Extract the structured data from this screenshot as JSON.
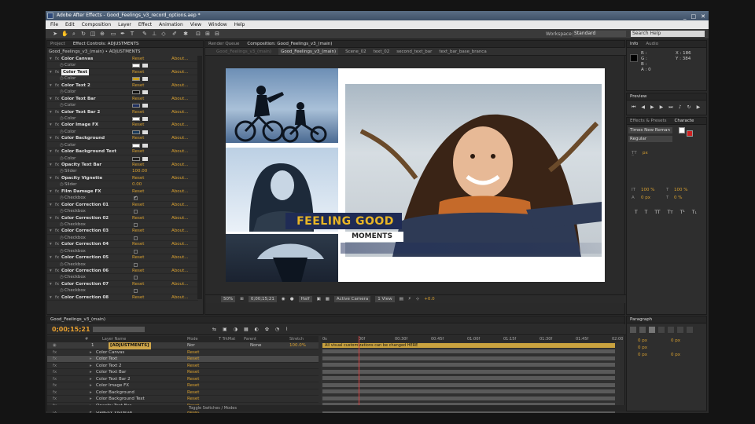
{
  "window": {
    "title": "Adobe After Effects - Good_Feelings_v3_record_options.aep *",
    "controls": [
      "_",
      "□",
      "✕"
    ]
  },
  "menu": [
    "File",
    "Edit",
    "Composition",
    "Layer",
    "Effect",
    "Animation",
    "View",
    "Window",
    "Help"
  ],
  "toolbar": {
    "workspace_label": "Workspace:",
    "workspace_value": "Standard",
    "search_placeholder": "Search Help"
  },
  "effects_panel": {
    "tabs": [
      "Project",
      "Effect Controls: ADJUSTMENTS"
    ],
    "header": "Good_Feelings_v3_(main) • ADJUSTMENTS",
    "reset_label": "Reset",
    "about_label": "About...",
    "rows": [
      {
        "name": "Color Canvas",
        "sub": "Color",
        "kind": "color",
        "swatch": "#ffffff"
      },
      {
        "name": "Color Text",
        "sub": "Color",
        "kind": "color",
        "swatch": "#c9a020"
      },
      {
        "name": "Color Text 2",
        "sub": "Color",
        "kind": "color",
        "swatch": "#111111"
      },
      {
        "name": "Color Text Bar",
        "sub": "Color",
        "kind": "color",
        "swatch": "#1e2f60"
      },
      {
        "name": "Color Text Bar 2",
        "sub": "Color",
        "kind": "color",
        "swatch": "#ffffff"
      },
      {
        "name": "Color Image FX",
        "sub": "Color",
        "kind": "color",
        "swatch": "#1a3a5a"
      },
      {
        "name": "Color Background",
        "sub": "Color",
        "kind": "color",
        "swatch": "#ffffff"
      },
      {
        "name": "Color Background Text",
        "sub": "Color",
        "kind": "color",
        "swatch": "#222222"
      },
      {
        "name": "Opacity Text Bar",
        "sub": "Slider",
        "kind": "slider",
        "value": "100.00"
      },
      {
        "name": "Opacity Vignette",
        "sub": "Slider",
        "kind": "slider",
        "value": "0.00"
      },
      {
        "name": "Film Damage FX",
        "sub": "Checkbox",
        "kind": "check",
        "checked": "✓"
      },
      {
        "name": "Color Correction 01",
        "sub": "Checkbox",
        "kind": "check"
      },
      {
        "name": "Color Correction 02",
        "sub": "Checkbox",
        "kind": "check"
      },
      {
        "name": "Color Correction 03",
        "sub": "Checkbox",
        "kind": "check"
      },
      {
        "name": "Color Correction 04",
        "sub": "Checkbox",
        "kind": "check"
      },
      {
        "name": "Color Correction 05",
        "sub": "Checkbox",
        "kind": "check"
      },
      {
        "name": "Color Correction 06",
        "sub": "Checkbox",
        "kind": "check"
      },
      {
        "name": "Color Correction 07",
        "sub": "Checkbox",
        "kind": "check"
      },
      {
        "name": "Color Correction 08",
        "sub": "",
        "kind": "head"
      }
    ]
  },
  "comp_panel": {
    "tabs": [
      "Render Queue",
      "Composition: Good_Feelings_v3_(main)"
    ],
    "subtabs": [
      "Good_Feelings_v3_(main)",
      "Scene_02",
      "text_02",
      "second_text_bar",
      "text_bar_base_branca"
    ],
    "ghost_tab": "Good_Feelings_v3_(main)",
    "headline": "FEELING GOOD",
    "subline": "MOMENTS",
    "zoom": "50%",
    "timecode": "0;00;15;21",
    "resolution": "Half",
    "camera": "Active Camera",
    "view": "1 View",
    "exposure": "+0.0"
  },
  "info_panel": {
    "tabs": [
      "Info",
      "Audio"
    ],
    "r": "R :",
    "g": "G :",
    "b": "B :",
    "a": "A : 0",
    "x": "X : 186",
    "y": "Y : 384"
  },
  "preview_panel": {
    "tab": "Preview"
  },
  "character_panel": {
    "tabs": [
      "Effects & Presets",
      "Characte"
    ],
    "font": "Times New Roman",
    "style": "Regular",
    "size_unit": "px",
    "values": [
      "100 %",
      "100 %",
      "0 px",
      "0 %"
    ]
  },
  "paragraph_panel": {
    "tab": "Paragraph",
    "indent": [
      "0 px",
      "0 px",
      "0 px",
      "0 px",
      "0 px"
    ]
  },
  "timeline": {
    "tab": "Good_Feelings_v3_(main)",
    "timecode": "0;00;15;21",
    "columns": [
      "#",
      "Layer Name",
      "Mode",
      "T TrkMat",
      "Parent",
      "Stretch"
    ],
    "adjust_layer": {
      "num": "1",
      "name": "[ADJUSTMENTS]",
      "mode": "Nor",
      "parent": "None",
      "stretch": "100.0%"
    },
    "ruler": [
      "0s",
      "00f",
      "00:30f",
      "00:45f",
      "01:00f",
      "01:15f",
      "01:30f",
      "01:45f",
      "02:00"
    ],
    "bar_text": "All visual customizations can be changed HERE",
    "reset_label": "Reset",
    "layers": [
      "Color Canvas",
      "Color Text",
      "Color Text 2",
      "Color Text Bar",
      "Color Text Bar 2",
      "Color Image FX",
      "Color Background",
      "Color Background Text",
      "Opacity Text Bar",
      "Opacity Vignette"
    ],
    "footer": "Toggle Switches / Modes"
  }
}
